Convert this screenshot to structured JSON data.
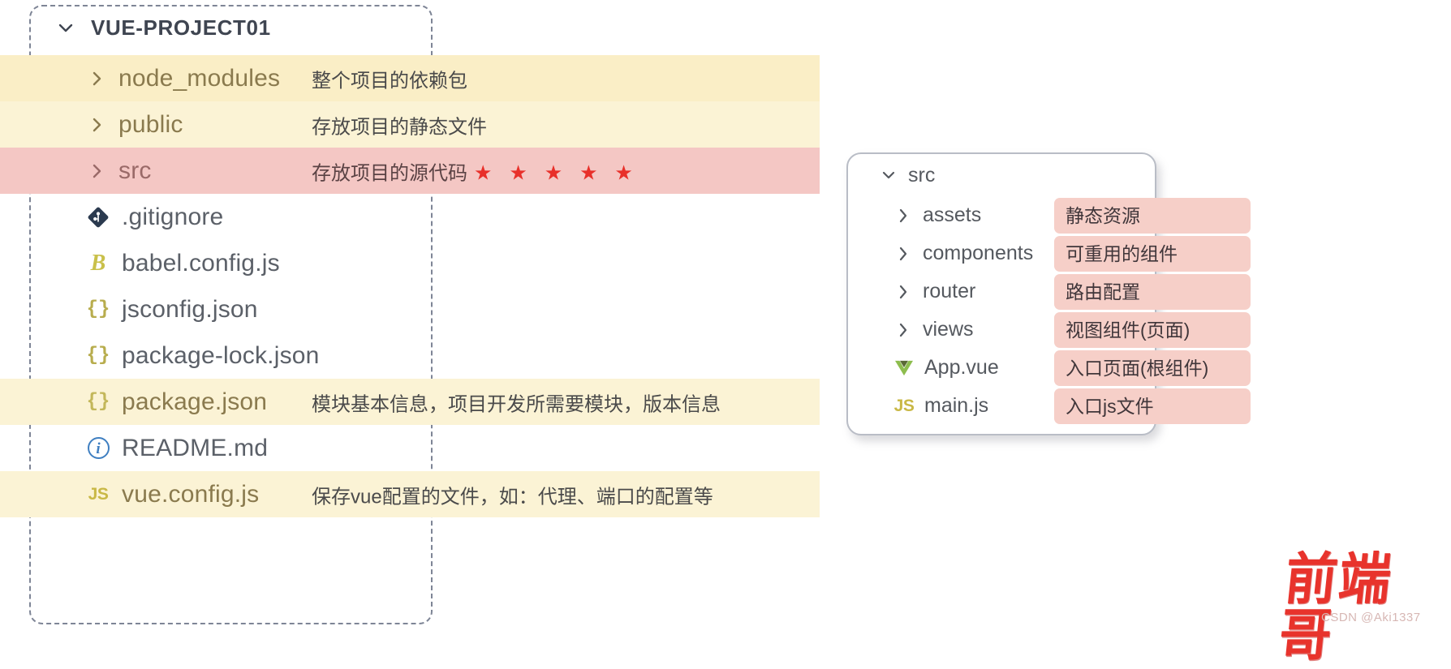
{
  "left_panel": {
    "root": {
      "label": "VUE-PROJECT01",
      "chevron": "chevron-down-icon",
      "expanded": true
    },
    "rows": [
      {
        "name": "node_modules",
        "desc": "整个项目的依赖包",
        "icon": "chevron-right-icon",
        "kind": "folder",
        "highlight": "yellow",
        "stars": ""
      },
      {
        "name": "public",
        "desc": "存放项目的静态文件",
        "icon": "chevron-right-icon",
        "kind": "folder",
        "highlight": "yellow-soft",
        "stars": ""
      },
      {
        "name": "src",
        "desc": "存放项目的源代码",
        "icon": "chevron-right-icon",
        "kind": "folder",
        "highlight": "pink",
        "stars": "★ ★ ★ ★ ★"
      },
      {
        "name": ".gitignore",
        "desc": "",
        "icon": "git-icon",
        "kind": "file",
        "highlight": "none",
        "stars": ""
      },
      {
        "name": "babel.config.js",
        "desc": "",
        "icon": "babel-icon",
        "kind": "file",
        "highlight": "none",
        "stars": ""
      },
      {
        "name": "jsconfig.json",
        "desc": "",
        "icon": "json-braces-icon",
        "kind": "file",
        "highlight": "none",
        "stars": ""
      },
      {
        "name": "package-lock.json",
        "desc": "",
        "icon": "json-braces-icon",
        "kind": "file",
        "highlight": "none",
        "stars": ""
      },
      {
        "name": "package.json",
        "desc": "模块基本信息，项目开发所需要模块，版本信息",
        "icon": "json-braces-icon",
        "kind": "file",
        "highlight": "yellow-soft",
        "stars": ""
      },
      {
        "name": "README.md",
        "desc": "",
        "icon": "info-circle-icon",
        "kind": "file",
        "highlight": "none",
        "stars": ""
      },
      {
        "name": "vue.config.js",
        "desc": "保存vue配置的文件，如：代理、端口的配置等",
        "icon": "js-icon",
        "kind": "file",
        "highlight": "yellow-soft",
        "stars": ""
      }
    ]
  },
  "right_panel": {
    "root": {
      "label": "src",
      "chevron": "chevron-down-icon",
      "expanded": true
    },
    "rows": [
      {
        "name": "assets",
        "badge": "静态资源",
        "icon": "chevron-right-icon",
        "kind": "folder"
      },
      {
        "name": "components",
        "badge": "可重用的组件",
        "icon": "chevron-right-icon",
        "kind": "folder"
      },
      {
        "name": "router",
        "badge": "路由配置",
        "icon": "chevron-right-icon",
        "kind": "folder"
      },
      {
        "name": "views",
        "badge": "视图组件(页面)",
        "icon": "chevron-right-icon",
        "kind": "folder"
      },
      {
        "name": "App.vue",
        "badge": "入口页面(根组件)",
        "icon": "vue-icon",
        "kind": "file"
      },
      {
        "name": "main.js",
        "badge": "入口js文件",
        "icon": "js-icon",
        "kind": "file"
      }
    ]
  },
  "watermark": {
    "text": "前端哥",
    "subtext": "CSDN @Aki1337"
  },
  "colors": {
    "highlight_yellow": "#faeec6",
    "highlight_yellow_soft": "#fbf3d5",
    "highlight_pink": "#f4c7c4",
    "badge_pink": "#f6cfc8",
    "star_red": "#e8302a",
    "watermark_red": "#e8332c",
    "panel_border": "#7e8596"
  }
}
